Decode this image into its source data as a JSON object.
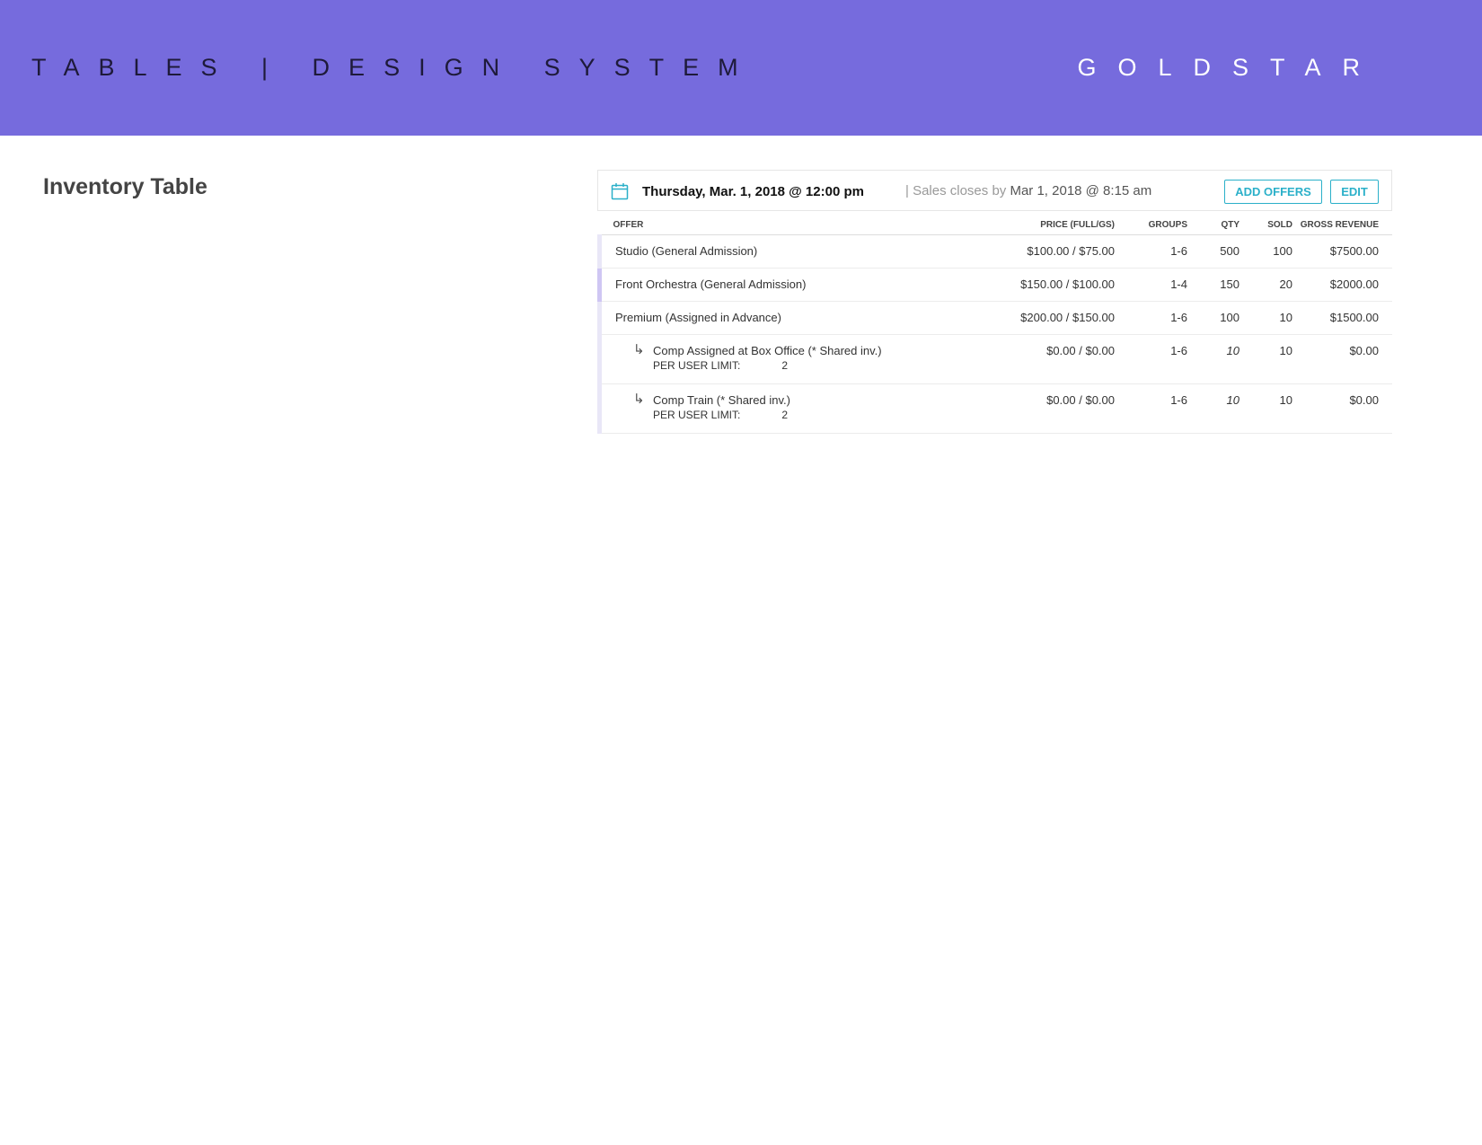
{
  "banner": {
    "title": "TABLES | DESIGN SYSTEM",
    "brand": "GOLDSTAR",
    "background_color": "#766bdd"
  },
  "section": {
    "title": "Inventory Table"
  },
  "inventory": {
    "event_date": "Thursday, Mar. 1, 2018 @ 12:00 pm",
    "sales_closes_label": "| Sales closes by",
    "sales_closes_date": "Mar 1, 2018 @ 8:15 am",
    "calendar_icon": "calendar-icon",
    "accent_color": "#2bb0c9",
    "buttons": {
      "add_offers": "ADD OFFERS",
      "edit": "EDIT"
    },
    "columns": {
      "offer": "OFFER",
      "price": "PRICE (FULL/GS)",
      "groups": "GROUPS",
      "qty": "QTY",
      "sold": "SOLD",
      "gross": "GROSS REVENUE"
    },
    "rows": [
      {
        "offer": "Studio (General Admission)",
        "price": "$100.00 / $75.00",
        "groups": "1-6",
        "qty": "500",
        "sold": "100",
        "gross": "$7500.00"
      },
      {
        "offer": "Front Orchestra (General Admission)",
        "price": "$150.00 / $100.00",
        "groups": "1-4",
        "qty": "150",
        "sold": "20",
        "gross": "$2000.00"
      },
      {
        "offer": "Premium (Assigned in Advance)",
        "price": "$200.00 / $150.00",
        "groups": "1-6",
        "qty": "100",
        "sold": "10",
        "gross": "$1500.00"
      }
    ],
    "sub_rows": [
      {
        "arrow": "↳",
        "offer": "Comp Assigned at Box Office (* Shared inv.)",
        "limit_label": "PER USER LIMIT:",
        "limit_value": "2",
        "price": "$0.00 / $0.00",
        "groups": "1-6",
        "qty": "10",
        "sold": "10",
        "gross": "$0.00"
      },
      {
        "arrow": "↳",
        "offer": "Comp Train (* Shared inv.)",
        "limit_label": "PER USER LIMIT:",
        "limit_value": "2",
        "price": "$0.00 / $0.00",
        "groups": "1-6",
        "qty": "10",
        "sold": "10",
        "gross": "$0.00"
      }
    ]
  }
}
